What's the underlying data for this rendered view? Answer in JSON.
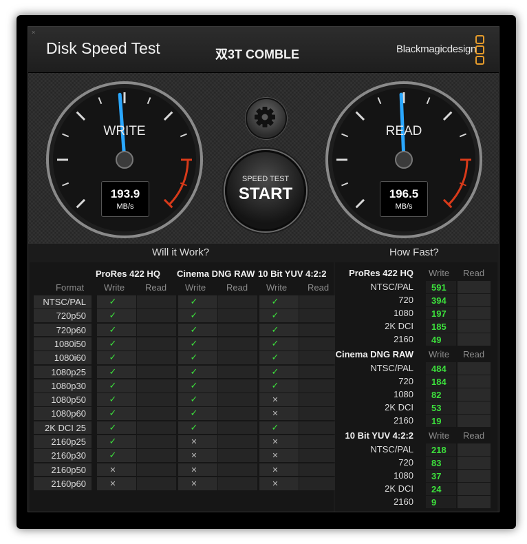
{
  "window": {
    "close_glyph": "×",
    "title": "Disk Speed Test",
    "disk_name": "双3T COMBLE",
    "brand": "Blackmagicdesign"
  },
  "gauges": {
    "write": {
      "label": "WRITE",
      "value": "193.9",
      "unit": "MB/s"
    },
    "read": {
      "label": "READ",
      "value": "196.5",
      "unit": "MB/s"
    }
  },
  "start_button": {
    "line1": "SPEED TEST",
    "line2": "START"
  },
  "will_it_work": {
    "title": "Will it Work?",
    "format_label": "Format",
    "codecs": [
      "ProRes 422 HQ",
      "Cinema DNG RAW",
      "10 Bit YUV 4:2:2"
    ],
    "write_label": "Write",
    "read_label": "Read",
    "rows": [
      {
        "format": "NTSC/PAL",
        "marks": [
          "✓",
          "✓",
          "✓"
        ]
      },
      {
        "format": "720p50",
        "marks": [
          "✓",
          "✓",
          "✓"
        ]
      },
      {
        "format": "720p60",
        "marks": [
          "✓",
          "✓",
          "✓"
        ]
      },
      {
        "format": "1080i50",
        "marks": [
          "✓",
          "✓",
          "✓"
        ]
      },
      {
        "format": "1080i60",
        "marks": [
          "✓",
          "✓",
          "✓"
        ]
      },
      {
        "format": "1080p25",
        "marks": [
          "✓",
          "✓",
          "✓"
        ]
      },
      {
        "format": "1080p30",
        "marks": [
          "✓",
          "✓",
          "✓"
        ]
      },
      {
        "format": "1080p50",
        "marks": [
          "✓",
          "✓",
          "✕"
        ]
      },
      {
        "format": "1080p60",
        "marks": [
          "✓",
          "✓",
          "✕"
        ]
      },
      {
        "format": "2K DCI 25",
        "marks": [
          "✓",
          "✓",
          "✓"
        ]
      },
      {
        "format": "2160p25",
        "marks": [
          "✓",
          "✕",
          "✕"
        ]
      },
      {
        "format": "2160p30",
        "marks": [
          "✓",
          "✕",
          "✕"
        ]
      },
      {
        "format": "2160p50",
        "marks": [
          "✕",
          "✕",
          "✕"
        ]
      },
      {
        "format": "2160p60",
        "marks": [
          "✕",
          "✕",
          "✕"
        ]
      }
    ]
  },
  "how_fast": {
    "title": "How Fast?",
    "write_label": "Write",
    "read_label": "Read",
    "groups": [
      {
        "codec": "ProRes 422 HQ",
        "rows": [
          {
            "format": "NTSC/PAL",
            "write": "591"
          },
          {
            "format": "720",
            "write": "394"
          },
          {
            "format": "1080",
            "write": "197"
          },
          {
            "format": "2K DCI",
            "write": "185"
          },
          {
            "format": "2160",
            "write": "49"
          }
        ]
      },
      {
        "codec": "Cinema DNG RAW",
        "rows": [
          {
            "format": "NTSC/PAL",
            "write": "484"
          },
          {
            "format": "720",
            "write": "184"
          },
          {
            "format": "1080",
            "write": "82"
          },
          {
            "format": "2K DCI",
            "write": "53"
          },
          {
            "format": "2160",
            "write": "19"
          }
        ]
      },
      {
        "codec": "10 Bit YUV 4:2:2",
        "rows": [
          {
            "format": "NTSC/PAL",
            "write": "218"
          },
          {
            "format": "720",
            "write": "83"
          },
          {
            "format": "1080",
            "write": "37"
          },
          {
            "format": "2K DCI",
            "write": "24"
          },
          {
            "format": "2160",
            "write": "9"
          }
        ]
      }
    ]
  },
  "colors": {
    "accent_blue": "#2aa7ff",
    "ok_green": "#3ce03c",
    "redline": "#d83a1a",
    "brand_orange": "#e59b2b"
  },
  "icons": {
    "gear": "gear-icon",
    "close": "close-icon"
  }
}
